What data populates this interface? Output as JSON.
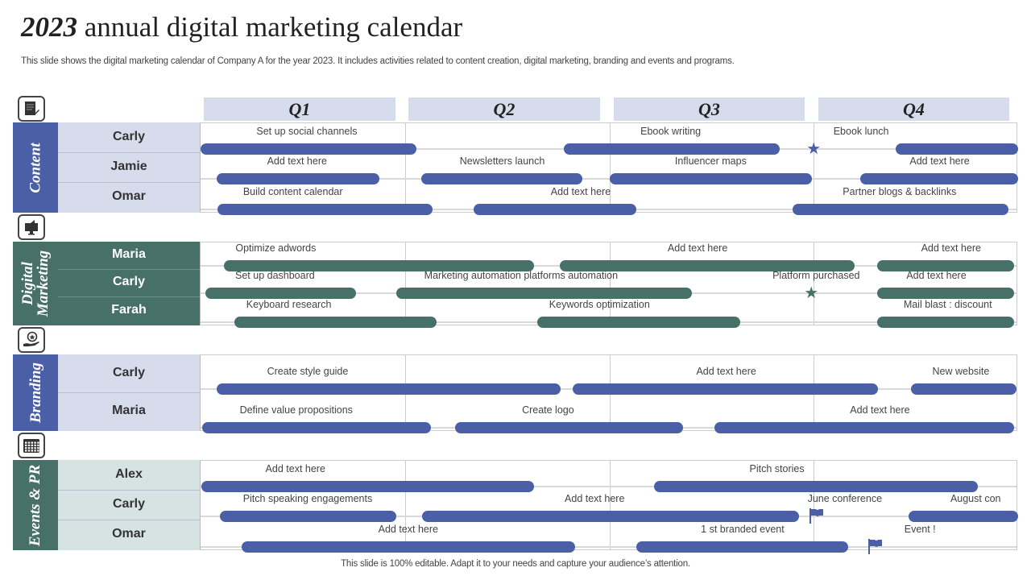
{
  "title": {
    "year": "2023",
    "rest": " annual digital marketing calendar"
  },
  "subtitle": "This slide shows the digital marketing calendar of Company A for the year 2023. It includes activities related to content creation, digital marketing, branding and events and programs.",
  "footer": "This slide is 100% editable. Adapt it to your needs and capture your audience’s attention.",
  "quarters": [
    "Q1",
    "Q2",
    "Q3",
    "Q4"
  ],
  "colors": {
    "blue": "#4a5fa5",
    "teal": "#477069",
    "lightblue": "#d6dceb",
    "lightteal": "#d5e4e2"
  },
  "sections": [
    {
      "label": "Content",
      "icon": "document-edit-icon",
      "theme": "blue",
      "rows": [
        {
          "name": "Carly",
          "bars": [
            [
              0.0,
              0.264
            ],
            [
              0.444,
              0.708
            ],
            [
              0.85,
              1.0
            ]
          ],
          "labels": [
            {
              "text": "Set up social channels",
              "at": 0.13
            },
            {
              "text": "Ebook writing",
              "at": 0.575
            },
            {
              "text": "Ebook lunch",
              "at": 0.808
            }
          ],
          "markers": [
            {
              "type": "star",
              "at": 0.75
            }
          ]
        },
        {
          "name": "Jamie",
          "bars": [
            [
              0.02,
              0.219
            ],
            [
              0.27,
              0.467
            ],
            [
              0.5,
              0.748
            ],
            [
              0.807,
              1.0
            ]
          ],
          "labels": [
            {
              "text": "Add text here",
              "at": 0.118
            },
            {
              "text": "Newsletters  launch",
              "at": 0.369
            },
            {
              "text": "Influencer  maps",
              "at": 0.624
            },
            {
              "text": "Add text here",
              "at": 0.904
            }
          ],
          "markers": []
        },
        {
          "name": "Omar",
          "bars": [
            [
              0.021,
              0.284
            ],
            [
              0.334,
              0.533
            ],
            [
              0.724,
              0.988
            ]
          ],
          "labels": [
            {
              "text": "Build content calendar",
              "at": 0.113
            },
            {
              "text": "Add text here",
              "at": 0.465
            },
            {
              "text": "Partner blogs & backlinks",
              "at": 0.855
            }
          ],
          "markers": []
        }
      ]
    },
    {
      "label": "Digital Marketing",
      "icon": "monitor-megaphone-icon",
      "theme": "teal",
      "rows": [
        {
          "name": "Maria",
          "bars": [
            [
              0.029,
              0.408
            ],
            [
              0.439,
              0.8
            ],
            [
              0.828,
              0.995
            ]
          ],
          "labels": [
            {
              "text": "Optimize adwords",
              "at": 0.092
            },
            {
              "text": "Add text here",
              "at": 0.608
            },
            {
              "text": "Add text here",
              "at": 0.918
            }
          ],
          "markers": []
        },
        {
          "name": "Carly",
          "bars": [
            [
              0.006,
              0.19
            ],
            [
              0.239,
              0.601
            ],
            [
              0.828,
              0.995
            ]
          ],
          "labels": [
            {
              "text": "Set up dashboard",
              "at": 0.091
            },
            {
              "text": "Marketing automation platforms automation",
              "at": 0.392
            },
            {
              "text": "Platform purchased",
              "at": 0.753
            },
            {
              "text": "Add text here",
              "at": 0.9
            }
          ],
          "markers": [
            {
              "type": "star",
              "at": 0.747
            }
          ]
        },
        {
          "name": "Farah",
          "bars": [
            [
              0.041,
              0.289
            ],
            [
              0.412,
              0.66
            ],
            [
              0.828,
              0.995
            ]
          ],
          "labels": [
            {
              "text": "Keyboard research",
              "at": 0.108
            },
            {
              "text": "Keywords optimization",
              "at": 0.488
            },
            {
              "text": "Mail blast : discount",
              "at": 0.914
            }
          ],
          "markers": []
        }
      ]
    },
    {
      "label": "Branding",
      "icon": "hand-award-icon",
      "theme": "blue",
      "rows": [
        {
          "name": "Carly",
          "bars": [
            [
              0.02,
              0.44
            ],
            [
              0.455,
              0.829
            ],
            [
              0.869,
              0.998
            ]
          ],
          "labels": [
            {
              "text": "Create  style guide",
              "at": 0.131
            },
            {
              "text": "Add text here",
              "at": 0.643
            },
            {
              "text": "New website",
              "at": 0.93
            }
          ],
          "markers": []
        },
        {
          "name": "Maria",
          "bars": [
            [
              0.002,
              0.282
            ],
            [
              0.311,
              0.59
            ],
            [
              0.629,
              0.995
            ]
          ],
          "labels": [
            {
              "text": "Define  value  propositions",
              "at": 0.117
            },
            {
              "text": "Create  logo",
              "at": 0.425
            },
            {
              "text": "Add text here",
              "at": 0.831
            }
          ],
          "markers": []
        }
      ]
    },
    {
      "label": "Events & PR",
      "icon": "calendar-icon",
      "theme": "teal",
      "barColor": "blue",
      "rows": [
        {
          "name": "Alex",
          "bars": [
            [
              0.001,
              0.408
            ],
            [
              0.555,
              0.951
            ]
          ],
          "labels": [
            {
              "text": "Add text here",
              "at": 0.116
            },
            {
              "text": "Pitch stories",
              "at": 0.705
            }
          ],
          "markers": []
        },
        {
          "name": "Carly",
          "bars": [
            [
              0.024,
              0.239
            ],
            [
              0.271,
              0.732
            ],
            [
              0.866,
              1.0
            ]
          ],
          "labels": [
            {
              "text": "Pitch speaking  engagements",
              "at": 0.131
            },
            {
              "text": "Add text here",
              "at": 0.482
            },
            {
              "text": "June  conference",
              "at": 0.788
            },
            {
              "text": "August con",
              "at": 0.948
            }
          ],
          "markers": [
            {
              "type": "flag",
              "at": 0.747
            }
          ]
        },
        {
          "name": "Omar",
          "bars": [
            [
              0.05,
              0.458
            ],
            [
              0.533,
              0.792
            ]
          ],
          "labels": [
            {
              "text": "Add text here",
              "at": 0.254
            },
            {
              "text": "1 st branded  event",
              "at": 0.663
            },
            {
              "text": "Event  !",
              "at": 0.88
            }
          ],
          "markers": [
            {
              "type": "flag",
              "at": 0.819
            }
          ]
        }
      ]
    }
  ]
}
